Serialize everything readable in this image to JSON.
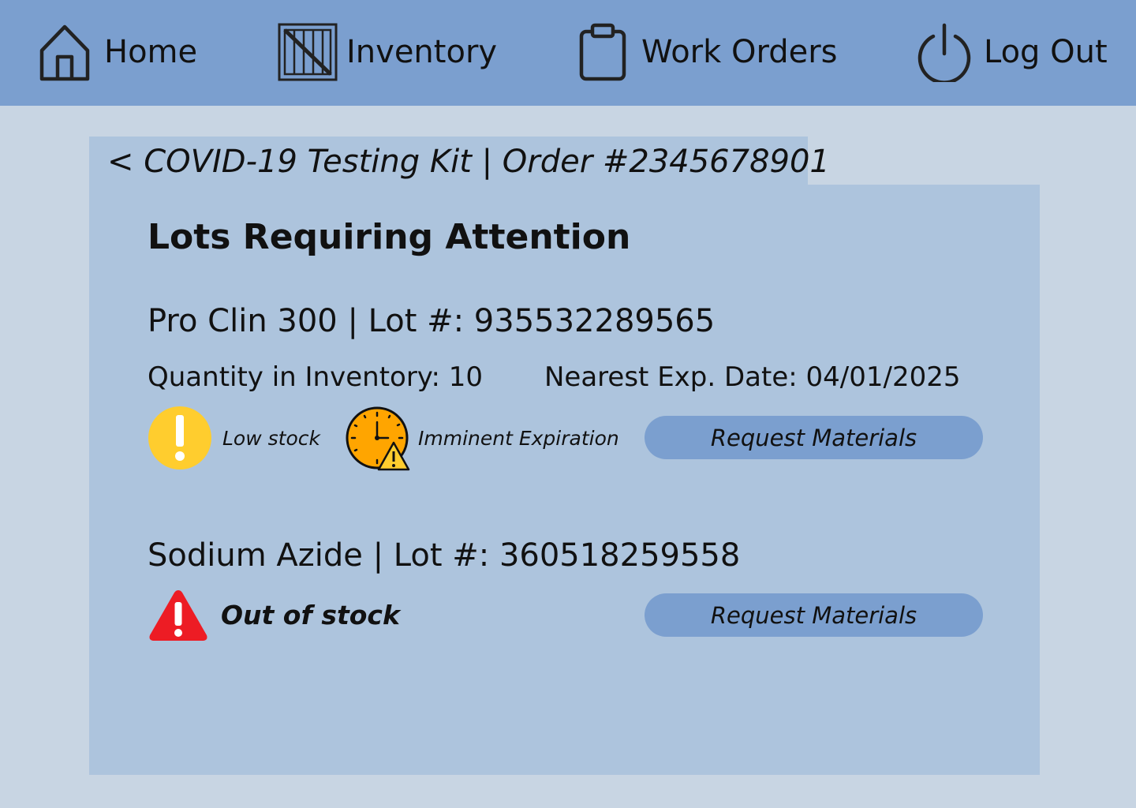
{
  "nav": {
    "home": {
      "label": "Home",
      "icon": "home-icon"
    },
    "inventory": {
      "label": "Inventory",
      "icon": "crate-icon"
    },
    "work_orders": {
      "label": "Work Orders",
      "icon": "clipboard-icon"
    },
    "log_out": {
      "label": "Log Out",
      "icon": "power-icon"
    }
  },
  "breadcrumb": "< COVID-19 Testing Kit | Order #2345678901",
  "section_title": "Lots Requiring Attention",
  "lots": [
    {
      "title": "Pro Clin 300 | Lot #: 935532289565",
      "quantity": "Quantity in Inventory: 10",
      "expiration": "Nearest Exp. Date: 04/01/2025",
      "statuses": [
        {
          "label": "Low stock",
          "icon": "exclamation-icon",
          "color": "#ffcd2e"
        },
        {
          "label": "Imminent Expiration",
          "icon": "clock-warning-icon",
          "color": "#ffa500"
        }
      ],
      "action": "Request Materials"
    },
    {
      "title": "Sodium Azide | Lot #: 360518259558",
      "statuses": [
        {
          "label": "Out of stock",
          "icon": "alert-triangle-icon",
          "color": "#ed1c24"
        }
      ],
      "action": "Request Materials"
    }
  ],
  "colors": {
    "nav_background": "#7b9fcf",
    "page_background": "#c8d5e3",
    "panel_background": "#adc4dd",
    "button_background": "#7b9fcf"
  }
}
